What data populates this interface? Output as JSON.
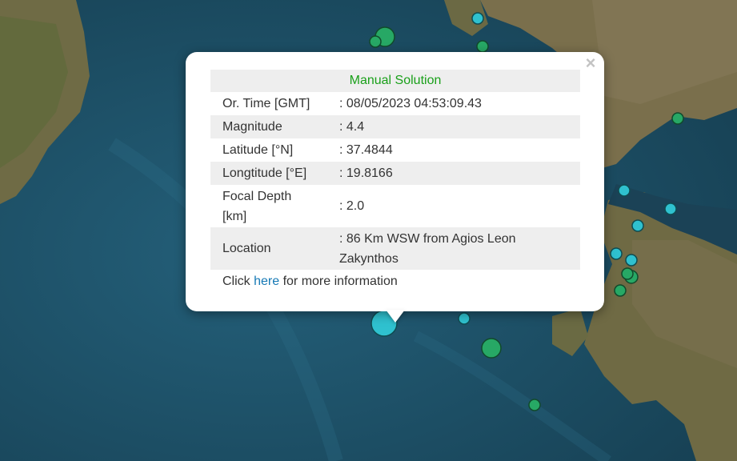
{
  "popup": {
    "close_glyph": "×",
    "title": "Manual Solution",
    "rows": [
      {
        "label": "Or. Time [GMT]",
        "value": ": 08/05/2023 04:53:09.43"
      },
      {
        "label": "Magnitude",
        "value": ": 4.4"
      },
      {
        "label": "Latitude [°N]",
        "value": ": 37.4844"
      },
      {
        "label": "Longtitude [°E]",
        "value": ": 19.8166"
      },
      {
        "label": "Focal Depth\n[km]",
        "value": ": 2.0"
      },
      {
        "label": "Location",
        "value": ": 86 Km WSW from Agios Leon\nZakynthos"
      }
    ],
    "more_prefix": "Click ",
    "more_link": "here",
    "more_suffix": " for more information"
  },
  "map": {
    "sea_color": "#1d4d63",
    "land_color": "#6e6a45",
    "marker_green": "#27a865",
    "marker_cyan": "#2fc1cf"
  }
}
